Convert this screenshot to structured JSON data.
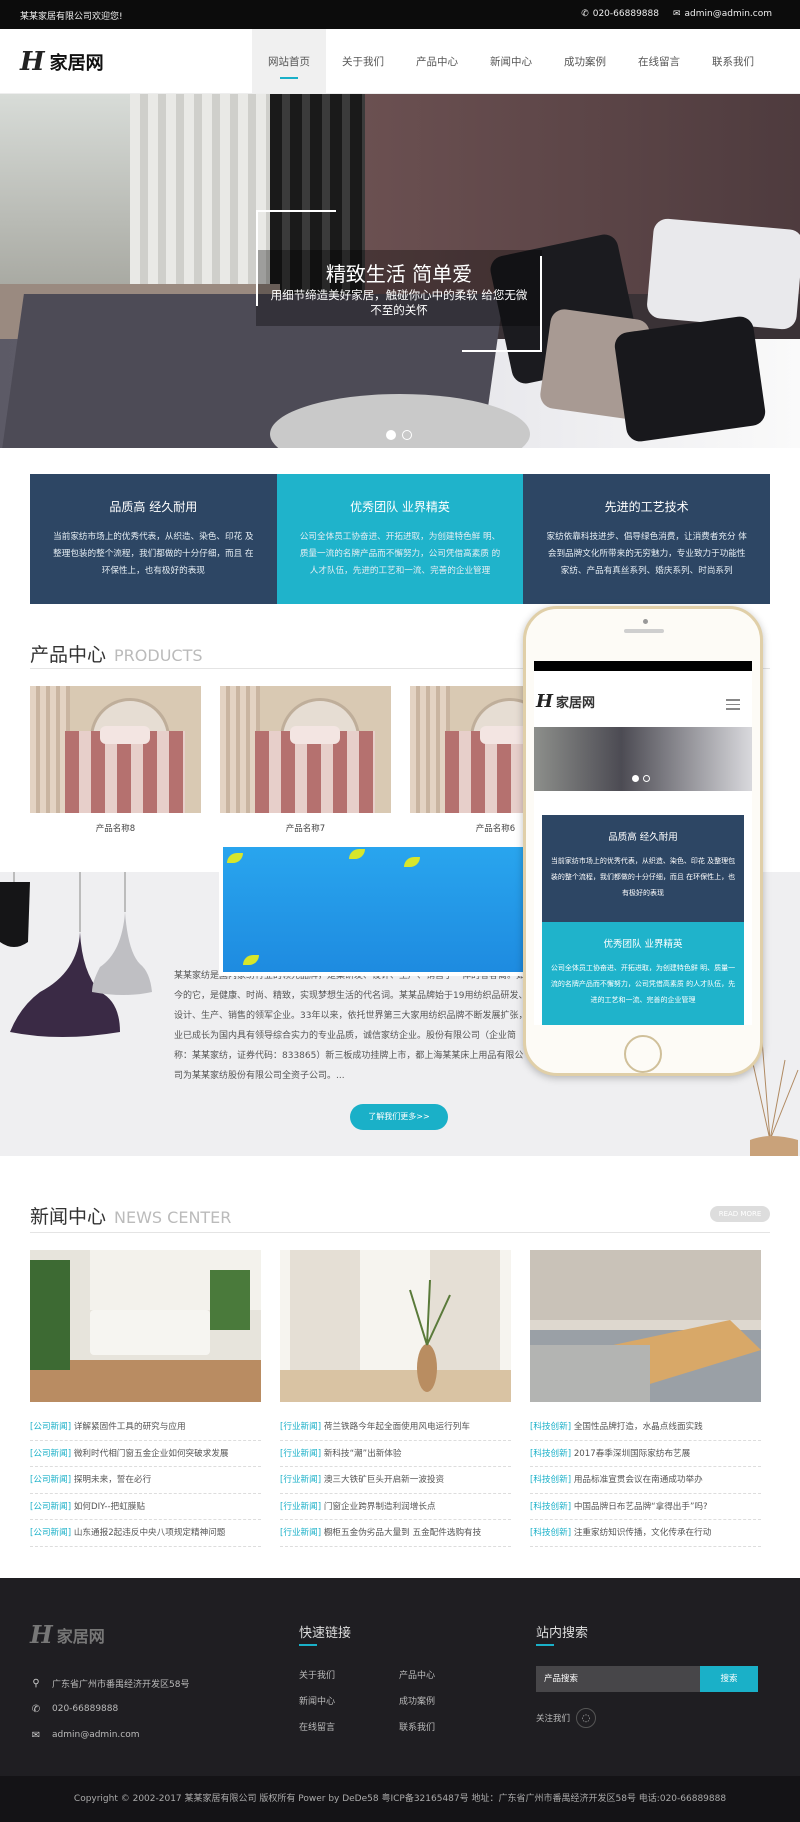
{
  "topbar": {
    "welcome": "某某家居有限公司欢迎您!",
    "phone": "020-66889888",
    "email": "admin@admin.com"
  },
  "header": {
    "logo_mark": "H",
    "logo_text": "家居网",
    "nav": [
      "网站首页",
      "关于我们",
      "产品中心",
      "新闻中心",
      "成功案例",
      "在线留言",
      "联系我们"
    ]
  },
  "banner": {
    "title": "精致生活 简单爱",
    "subtitle": "用细节缔造美好家居，触碰你心中的柔软 给您无微不至的关怀"
  },
  "features": [
    {
      "title": "品质高 经久耐用",
      "text": "当前家纺市场上的优秀代表，从织造、染色、印花 及整理包装的整个流程，我们都做的十分仔细，而且 在环保性上，也有极好的表现"
    },
    {
      "title": "优秀团队 业界精英",
      "text": "公司全体员工协奋进、开拓进取，为创建特色鲜 明、质量一流的名牌产品而不懈努力，公司凭借高素质 的人才队伍，先进的工艺和一流、完善的企业管理"
    },
    {
      "title": "先进的工艺技术",
      "text": "家纺依靠科技进步、倡导绿色消费，让消费者充分 体会到品牌文化所带来的无穷魅力，专业致力于功能性 家纺、产品有真丝系列、婚庆系列、时尚系列"
    }
  ],
  "products": {
    "title_cn": "产品中心",
    "title_en": "PRODUCTS",
    "items": [
      "产品名称8",
      "产品名称7",
      "产品名称6"
    ]
  },
  "about": {
    "text": "某某家纺是国内家纺行业的领先品牌，是集研发、设计、生产、销售于一体的者客裔。如今的它，是健康、时尚、精致，实现梦想生活的代名词。某某品牌始于19用纺织品研发、设计、生产、销售的领军企业。33年以来，依托世界第三大家用纺织品牌不断发展扩张，业已成长为国内具有领导综合实力的专业品质，诚信家纺企业。股份有限公司（企业简称：某某家纺，证券代码：833865）新三板成功挂牌上市，都上海某某床上用品有限公司为某某家纺股份有限公司全资子公司。...",
    "button": "了解我们更多>>"
  },
  "phone_mockup": {
    "logo_mark": "H",
    "logo_text": "家居网",
    "box1_title": "品质高 经久耐用",
    "box1_text": "当前家纺市场上的优秀代表，从织造、染色、印花 及整理包装的整个流程，我们都做的十分仔细，而且 在环保性上，也有极好的表现",
    "box2_title": "优秀团队 业界精英",
    "box2_text": "公司全体员工协奋进、开拓进取，为创建特色鲜 明、质量一流的名牌产品而不懈努力，公司凭借高素质 的人才队伍，先进的工艺和一流、完善的企业管理"
  },
  "news": {
    "title_cn": "新闻中心",
    "title_en": "NEWS CENTER",
    "read_more": "READ MORE",
    "columns": [
      {
        "items": [
          {
            "cat": "[公司新闻]",
            "title": "详解紧固件工具的研究与应用"
          },
          {
            "cat": "[公司新闻]",
            "title": "微利时代相门窗五金企业如何突破求发展"
          },
          {
            "cat": "[公司新闻]",
            "title": "探明未来，誓在必行"
          },
          {
            "cat": "[公司新闻]",
            "title": "如何DIY--把虹膜贴"
          },
          {
            "cat": "[公司新闻]",
            "title": "山东通报2起违反中央八项规定精神问题"
          }
        ]
      },
      {
        "items": [
          {
            "cat": "[行业新闻]",
            "title": "荷兰铁路今年起全面使用风电运行列车"
          },
          {
            "cat": "[行业新闻]",
            "title": "新科技“潮”出新体验"
          },
          {
            "cat": "[行业新闻]",
            "title": "澳三大铁矿巨头开启新一波投资"
          },
          {
            "cat": "[行业新闻]",
            "title": "门窗企业跨界制造利润增长点"
          },
          {
            "cat": "[行业新闻]",
            "title": "橱柜五金伪劣品大量到 五金配件选购有技"
          }
        ]
      },
      {
        "items": [
          {
            "cat": "[科技创新]",
            "title": "全国性品牌打造，水晶点线面实践"
          },
          {
            "cat": "[科技创新]",
            "title": "2017春季深圳国际家纺布艺展"
          },
          {
            "cat": "[科技创新]",
            "title": "用品标准宣贯会议在南通成功举办"
          },
          {
            "cat": "[科技创新]",
            "title": "中国品牌日布艺品牌“拿得出手”吗?"
          },
          {
            "cat": "[科技创新]",
            "title": "注重家纺知识传播，文化传承在行动"
          }
        ]
      }
    ]
  },
  "footer": {
    "logo_mark": "H",
    "logo_text": "家居网",
    "address": "广东省广州市番禺经济开发区58号",
    "phone": "020-66889888",
    "email": "admin@admin.com",
    "links_title": "快速链接",
    "links": [
      "关于我们",
      "产品中心",
      "新闻中心",
      "成功案例",
      "在线留言",
      "联系我们"
    ],
    "search_title": "站内搜索",
    "search_placeholder": "产品搜索",
    "search_button": "搜索",
    "follow": "关注我们",
    "copyright": "Copyright © 2002-2017 某某家居有限公司 版权所有 Power by DeDe58 粤ICP备32165487号 地址：广东省广州市番禺经济开发区58号 电话:020-66889888"
  },
  "colors": {
    "accent": "#1ab0c8",
    "navy": "#2d4664",
    "footer_bg": "#1f1e22"
  }
}
